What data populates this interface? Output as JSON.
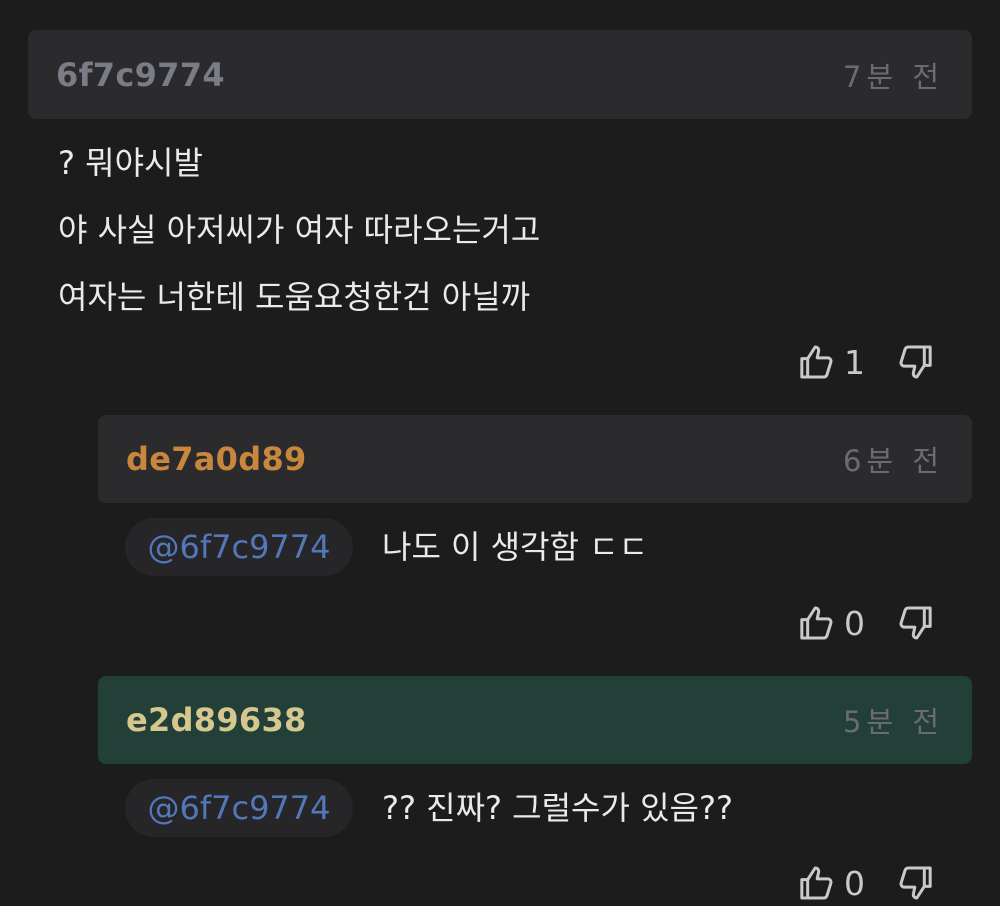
{
  "comments": [
    {
      "author": "6f7c9774",
      "author_color": "#7a7c86",
      "time": "7분 전",
      "lines": [
        "? 뭐야시발",
        "야 사실 아저씨가 여자 따라오는거고",
        "여자는 너한테 도움요청한건 아닐까"
      ],
      "likes": "1"
    },
    {
      "author": "de7a0d89",
      "author_color": "#c8873c",
      "time": "6분 전",
      "mention": "@6f7c9774",
      "text": "나도 이 생각함 ㄷㄷ",
      "likes": "0"
    },
    {
      "author": "e2d89638",
      "author_color": "#d5c78e",
      "time": "5분 전",
      "mention": "@6f7c9774",
      "text": "?? 진짜? 그럴수가 있음??",
      "likes": "0",
      "highlighted": true
    }
  ],
  "icons": {
    "like": "thumbs-up-icon",
    "dislike": "thumbs-down-icon"
  }
}
